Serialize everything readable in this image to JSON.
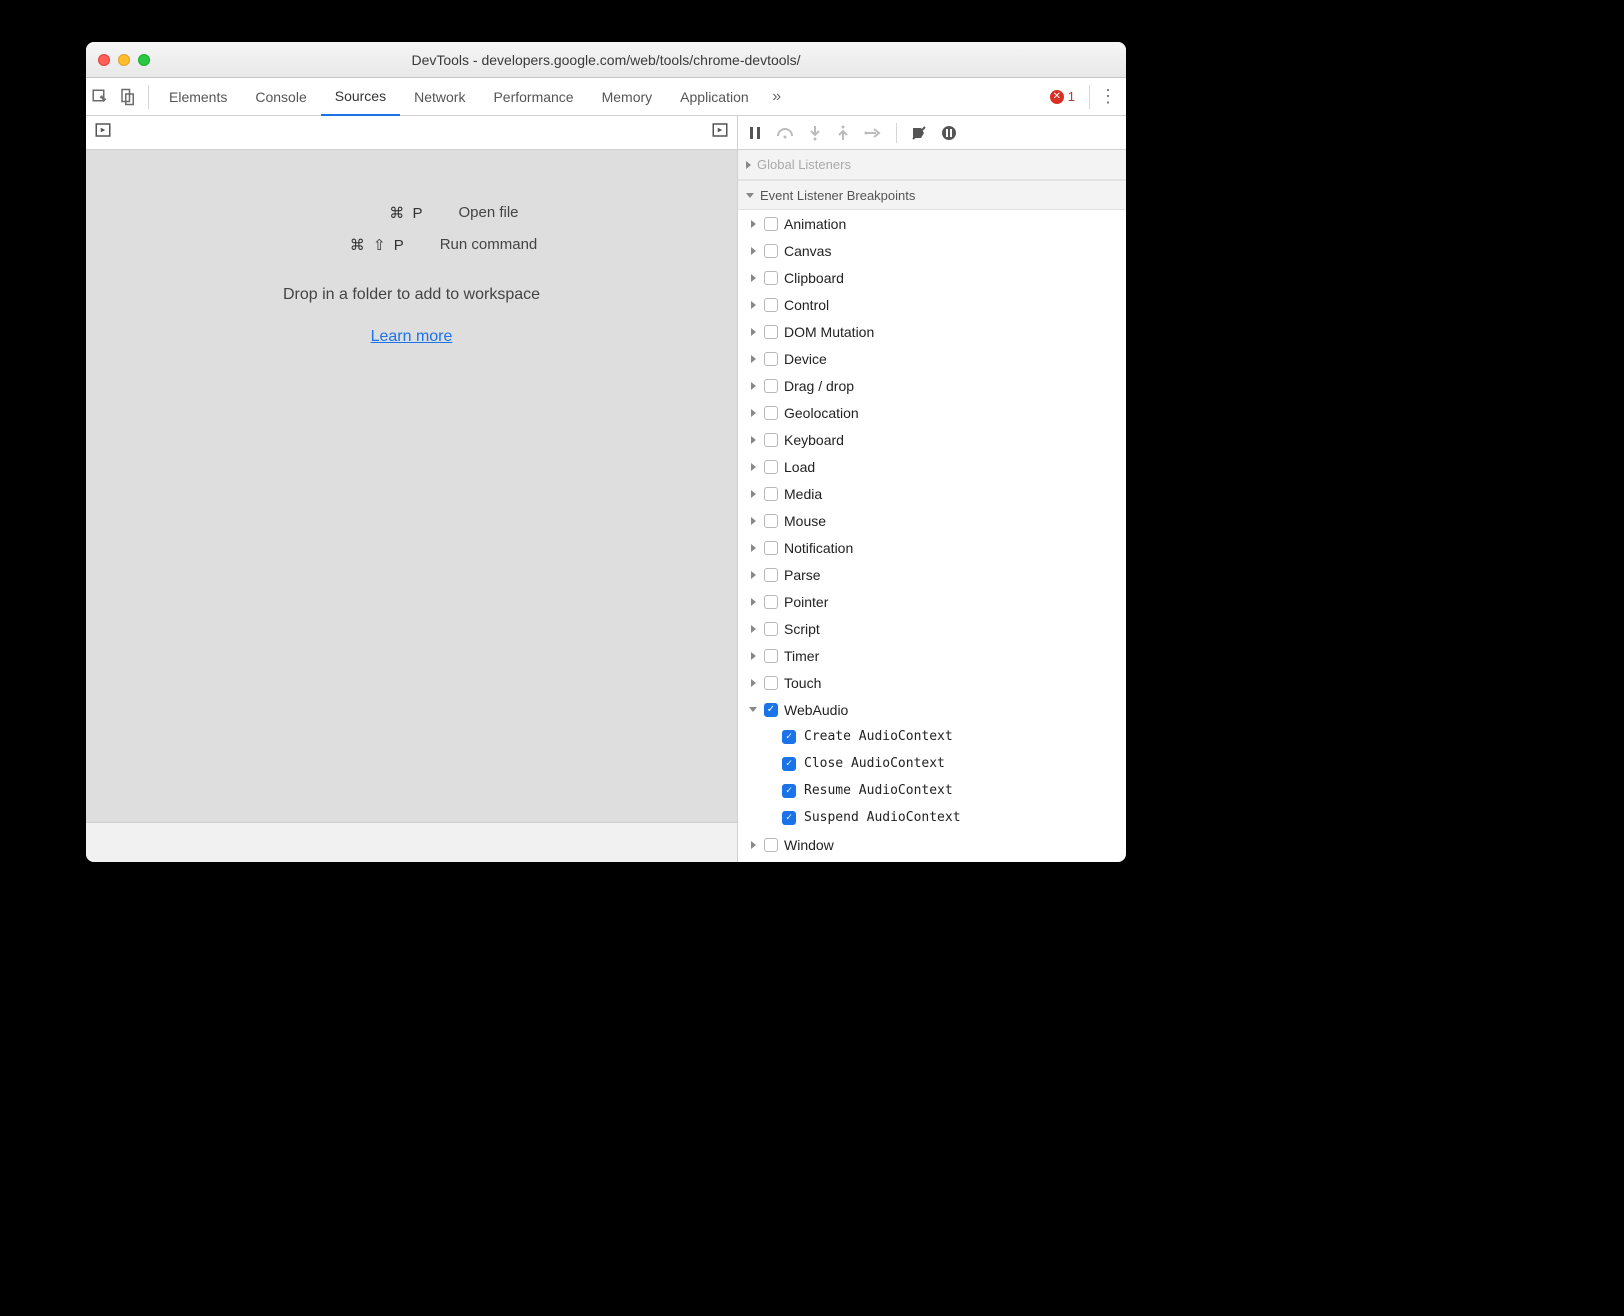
{
  "window": {
    "title": "DevTools - developers.google.com/web/tools/chrome-devtools/"
  },
  "tabs": {
    "items": [
      "Elements",
      "Console",
      "Sources",
      "Network",
      "Performance",
      "Memory",
      "Application"
    ],
    "active": "Sources",
    "error_count": "1"
  },
  "sources_panel": {
    "shortcut_open_keys": "⌘ P",
    "shortcut_open_label": "Open file",
    "shortcut_cmd_keys": "⌘ ⇧ P",
    "shortcut_cmd_label": "Run command",
    "drop_text": "Drop in a folder to add to workspace",
    "learn_more": "Learn more"
  },
  "right": {
    "global_listeners_label": "Global Listeners",
    "section_label": "Event Listener Breakpoints",
    "categories": [
      {
        "label": "Animation",
        "checked": false,
        "expanded": false
      },
      {
        "label": "Canvas",
        "checked": false,
        "expanded": false
      },
      {
        "label": "Clipboard",
        "checked": false,
        "expanded": false
      },
      {
        "label": "Control",
        "checked": false,
        "expanded": false
      },
      {
        "label": "DOM Mutation",
        "checked": false,
        "expanded": false
      },
      {
        "label": "Device",
        "checked": false,
        "expanded": false
      },
      {
        "label": "Drag / drop",
        "checked": false,
        "expanded": false
      },
      {
        "label": "Geolocation",
        "checked": false,
        "expanded": false
      },
      {
        "label": "Keyboard",
        "checked": false,
        "expanded": false
      },
      {
        "label": "Load",
        "checked": false,
        "expanded": false
      },
      {
        "label": "Media",
        "checked": false,
        "expanded": false
      },
      {
        "label": "Mouse",
        "checked": false,
        "expanded": false
      },
      {
        "label": "Notification",
        "checked": false,
        "expanded": false
      },
      {
        "label": "Parse",
        "checked": false,
        "expanded": false
      },
      {
        "label": "Pointer",
        "checked": false,
        "expanded": false
      },
      {
        "label": "Script",
        "checked": false,
        "expanded": false
      },
      {
        "label": "Timer",
        "checked": false,
        "expanded": false
      },
      {
        "label": "Touch",
        "checked": false,
        "expanded": false
      },
      {
        "label": "WebAudio",
        "checked": true,
        "expanded": true,
        "children": [
          {
            "label": "Create AudioContext",
            "checked": true
          },
          {
            "label": "Close AudioContext",
            "checked": true
          },
          {
            "label": "Resume AudioContext",
            "checked": true
          },
          {
            "label": "Suspend AudioContext",
            "checked": true
          }
        ]
      },
      {
        "label": "Window",
        "checked": false,
        "expanded": false
      }
    ]
  }
}
